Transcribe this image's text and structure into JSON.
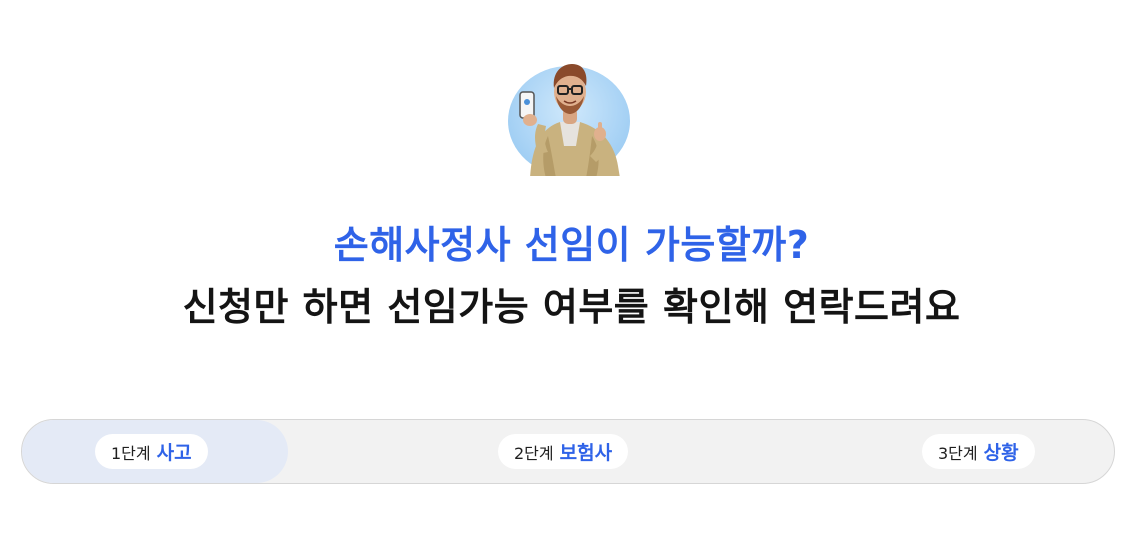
{
  "hero": {
    "avatar_icon": "person-holding-phone-thumbs-up-icon",
    "headline_blue": "손해사정사 선임이 가능할까?",
    "headline_dark": "신청만 하면 선임가능 여부를 확인해 연락드려요"
  },
  "steps": [
    {
      "number": "1단계",
      "name": "사고",
      "active": true
    },
    {
      "number": "2단계",
      "name": "보험사",
      "active": false
    },
    {
      "number": "3단계",
      "name": "상황",
      "active": false
    }
  ],
  "colors": {
    "accent": "#2f63e8",
    "text_dark": "#141414",
    "stepper_bg": "#f2f2f2",
    "active_step_bg": "#e4eaf6"
  }
}
